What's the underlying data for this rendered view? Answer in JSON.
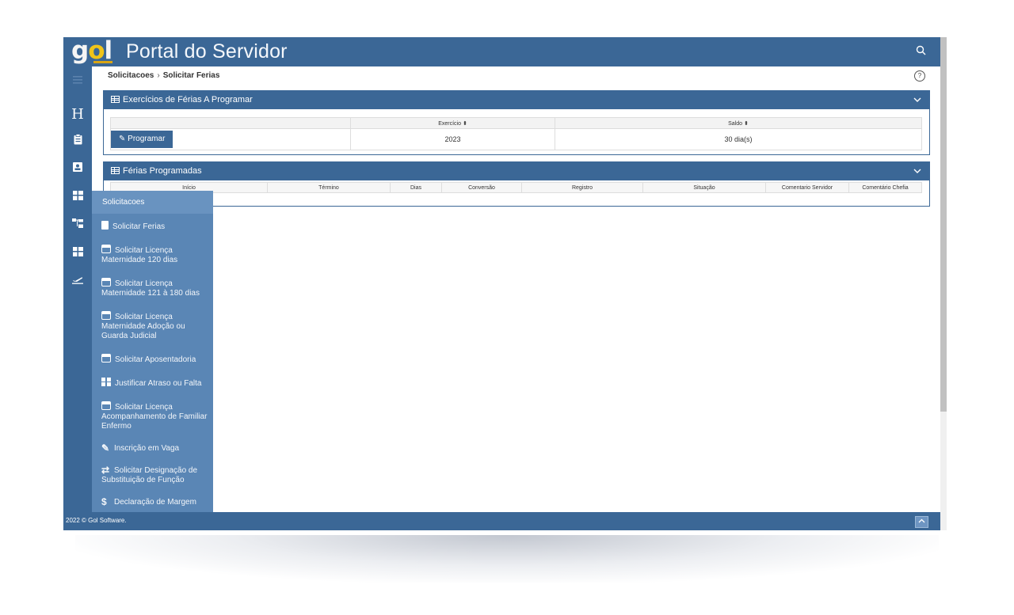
{
  "header": {
    "logo_text": "gol",
    "app_title": "Portal do Servidor",
    "search_icon": "search-icon"
  },
  "breadcrumb": {
    "parent": "Solicitacoes",
    "separator": "›",
    "current": "Solicitar Ferias"
  },
  "rail": {
    "items": [
      {
        "icon": "menu-icon"
      },
      {
        "icon": "letter-h-icon",
        "glyph": "H"
      },
      {
        "icon": "clipboard-icon"
      },
      {
        "icon": "id-card-icon"
      },
      {
        "icon": "dashboard-icon"
      },
      {
        "icon": "sitemap-icon"
      },
      {
        "icon": "dashboard-icon"
      },
      {
        "icon": "airplane-departure-icon"
      }
    ]
  },
  "panel_programar": {
    "title": "Exercícios de Férias A Programar",
    "columns": [
      "",
      "Exercício",
      "Saldo"
    ],
    "rows": [
      {
        "action": "Programar",
        "exercicio": "2023",
        "saldo": "30 dia(s)"
      }
    ]
  },
  "panel_programadas": {
    "title": "Férias Programadas",
    "columns": [
      "Início",
      "Término",
      "Dias",
      "Conversão",
      "Registro",
      "Situação",
      "Comentario Servidor",
      "Comentário Chefia"
    ]
  },
  "submenu": {
    "title": "Solicitacoes",
    "items": [
      {
        "label": "Solicitar Ferias",
        "icon": "document-icon"
      },
      {
        "label": "Solicitar Licença Maternidade 120 dias",
        "icon": "calendar-icon"
      },
      {
        "label": "Solicitar Licença Maternidade 121 à 180 dias",
        "icon": "calendar-icon"
      },
      {
        "label": "Solicitar Licença Maternidade Adoção ou Guarda Judicial",
        "icon": "calendar-icon"
      },
      {
        "label": "Solicitar Aposentadoria",
        "icon": "calendar-icon"
      },
      {
        "label": "Justificar Atraso ou Falta",
        "icon": "dashboard-icon"
      },
      {
        "label": "Solicitar Licença Acompanhamento de Familiar Enfermo",
        "icon": "calendar-icon"
      },
      {
        "label": "Inscrição em Vaga",
        "icon": "pencil-icon"
      },
      {
        "label": "Solicitar Designação de Substituição de Função",
        "icon": "exchange-icon"
      },
      {
        "label": "Declaração de Margem",
        "icon": "dollar-icon"
      }
    ]
  },
  "footer": {
    "copyright": "2022 © Gol Software.",
    "back_to_top_icon": "chevron-up-icon"
  },
  "colors": {
    "primary": "#3b6796",
    "submenu": "#5a86b5",
    "submenu_header": "#6993c0",
    "logo_accent": "#f0c419"
  }
}
